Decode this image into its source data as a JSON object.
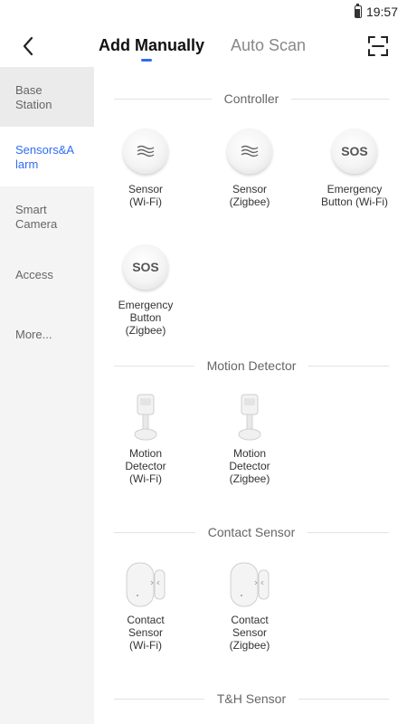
{
  "status_bar": {
    "time": "19:57"
  },
  "header": {
    "tab_manual": "Add Manually",
    "tab_scan": "Auto Scan"
  },
  "sidebar": {
    "items": [
      {
        "label": "Base Station"
      },
      {
        "label": "Sensors&Alarm"
      },
      {
        "label": "Smart Camera"
      },
      {
        "label": "Access"
      },
      {
        "label": "More..."
      }
    ]
  },
  "sections": {
    "controller": {
      "title": "Controller",
      "devices": [
        {
          "label": "Sensor (Wi-Fi)",
          "icon": "sensor-wave-icon"
        },
        {
          "label": "Sensor (Zigbee)",
          "icon": "sensor-wave-icon"
        },
        {
          "label": "Emergency Button (Wi-Fi)",
          "icon": "sos-button-icon",
          "icon_text": "SOS"
        },
        {
          "label": "Emergency Button (Zigbee)",
          "icon": "sos-button-icon",
          "icon_text": "SOS"
        }
      ]
    },
    "motion": {
      "title": "Motion Detector",
      "devices": [
        {
          "label": "Motion Detector (Wi-Fi)",
          "icon": "motion-detector-icon"
        },
        {
          "label": "Motion Detector (Zigbee)",
          "icon": "motion-detector-icon"
        }
      ]
    },
    "contact": {
      "title": "Contact Sensor",
      "devices": [
        {
          "label": "Contact Sensor (Wi-Fi)",
          "icon": "contact-sensor-icon"
        },
        {
          "label": "Contact Sensor (Zigbee)",
          "icon": "contact-sensor-icon"
        }
      ]
    },
    "th": {
      "title": "T&H Sensor"
    }
  },
  "colors": {
    "accent": "#2f6cf6",
    "sidebar_bg": "#f4f4f4"
  }
}
